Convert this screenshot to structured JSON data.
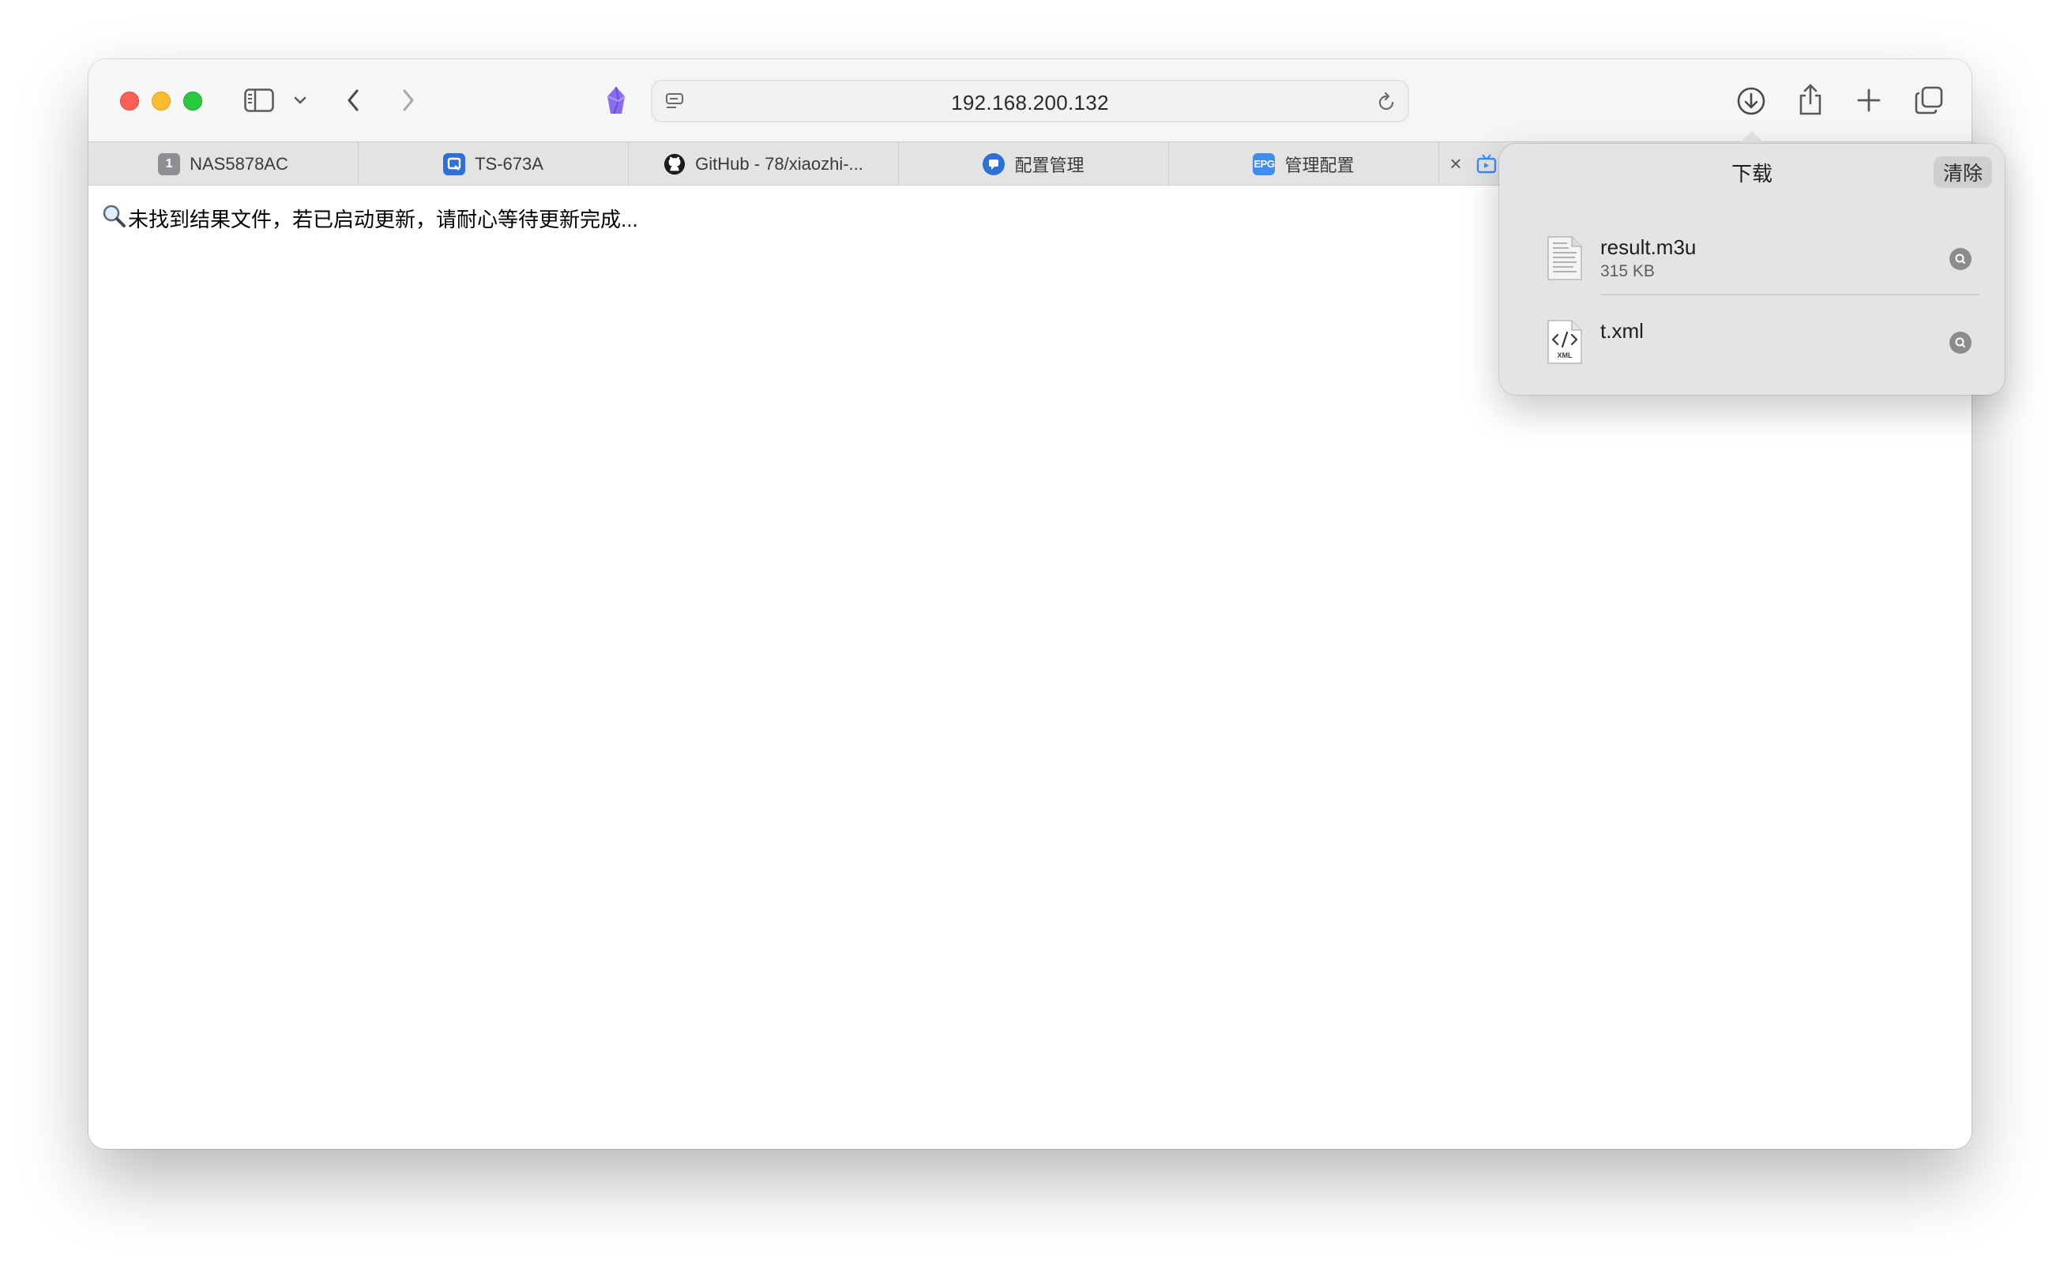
{
  "browser": {
    "url": "192.168.200.132"
  },
  "tabs": [
    {
      "label": "NAS5878AC",
      "favicon_text": "1",
      "favicon_color": "#8e8e93"
    },
    {
      "label": "TS-673A",
      "favicon_text": "Q",
      "favicon_color": "#2f6fd8"
    },
    {
      "label": "GitHub - 78/xiaozhi-...",
      "favicon_text": "",
      "favicon_color": "#1b1b1b"
    },
    {
      "label": "配置管理",
      "favicon_text": "",
      "favicon_color": "#2f6fd8"
    },
    {
      "label": "管理配置",
      "favicon_text": "EPG",
      "favicon_color": "#3d8ef0"
    }
  ],
  "page": {
    "message": "未找到结果文件，若已启动更新，请耐心等待更新完成..."
  },
  "downloads": {
    "title": "下载",
    "clear_label": "清除",
    "items": [
      {
        "name": "result.m3u",
        "size": "315 KB",
        "icon": "document-icon"
      },
      {
        "name": "t.xml",
        "size": "",
        "icon": "xml-file-icon",
        "badge": "XML"
      }
    ]
  },
  "colors": {
    "close": "#fe5f57",
    "minimize": "#febc2e",
    "zoom": "#28c840",
    "accent_purple": "#8a6cf0"
  }
}
